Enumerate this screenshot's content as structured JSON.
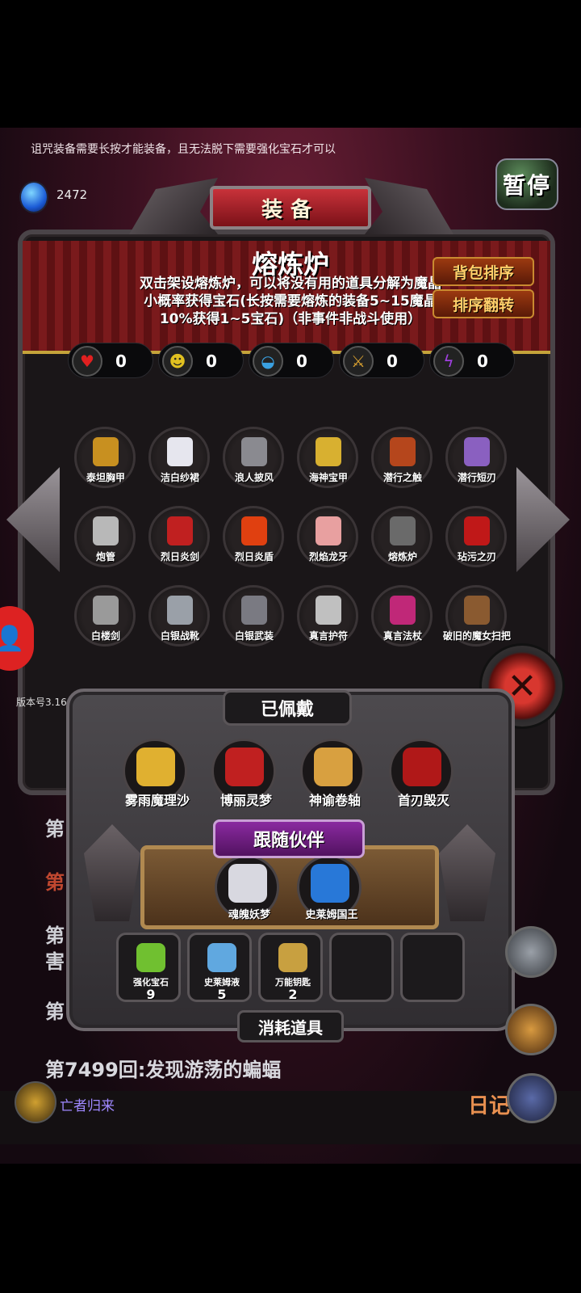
{
  "tip": "诅咒装备需要长按才能装备，且无法脱下需要强化宝石才可以",
  "gem_count": "2472",
  "pause_label": "暂停",
  "panel_title": "装备",
  "furnace": {
    "title": "熔炼炉",
    "description": "双击架设熔炼炉，可以将没有用的道具分解为魔晶小概率获得宝石(长按需要熔炼的装备5~15魔晶10%获得1~5宝石)（非事件非战斗使用）"
  },
  "sort_buttons": [
    "背包排序",
    "排序翻转"
  ],
  "stats": [
    {
      "icon": "heart-icon",
      "value": "0"
    },
    {
      "icon": "strength-icon",
      "value": "0"
    },
    {
      "icon": "helmet-icon",
      "value": "0"
    },
    {
      "icon": "sword-icon",
      "value": "0"
    },
    {
      "icon": "lightning-icon",
      "value": "0"
    }
  ],
  "items": [
    {
      "name": "泰坦胸甲",
      "icon": "gold-armor-icon",
      "color": "#c89020"
    },
    {
      "name": "洁白纱裙",
      "icon": "white-dress-icon",
      "color": "#e6e6ee"
    },
    {
      "name": "浪人披风",
      "icon": "cloak-icon",
      "color": "#8a8a90"
    },
    {
      "name": "海神宝甲",
      "icon": "gold-vest-icon",
      "color": "#d8b030"
    },
    {
      "name": "潜行之触",
      "icon": "glove-icon",
      "color": "#b5461c"
    },
    {
      "name": "潜行短刃",
      "icon": "dagger-icon",
      "color": "#8a60c0"
    },
    {
      "name": "炮管",
      "icon": "cannon-icon",
      "color": "#b8b8b8"
    },
    {
      "name": "烈日炎剑",
      "icon": "flame-sword-icon",
      "color": "#c02020"
    },
    {
      "name": "烈日炎盾",
      "icon": "sun-shield-icon",
      "color": "#e04010"
    },
    {
      "name": "烈焰龙牙",
      "icon": "fang-icon",
      "color": "#e8a0a0"
    },
    {
      "name": "熔炼炉",
      "icon": "cauldron-icon",
      "color": "#6a6a6a"
    },
    {
      "name": "玷污之刃",
      "icon": "cursed-blade-icon",
      "color": "#c01818"
    },
    {
      "name": "白楼剑",
      "icon": "katana-icon",
      "color": "#9a9a9a"
    },
    {
      "name": "白银战靴",
      "icon": "boots-icon",
      "color": "#9aa0a8"
    },
    {
      "name": "白银武装",
      "icon": "knight-armor-icon",
      "color": "#7a7a82"
    },
    {
      "name": "真言护符",
      "icon": "amulet-icon",
      "color": "#c0c0c0"
    },
    {
      "name": "真言法杖",
      "icon": "staff-icon",
      "color": "#c02878"
    },
    {
      "name": "破旧的魔女扫把",
      "icon": "broom-icon",
      "color": "#8a5a30"
    }
  ],
  "version": "版本号3.16",
  "worn": {
    "label": "已佩戴",
    "slots": [
      {
        "name": "雾雨魔理沙",
        "icon": "marisa-icon",
        "color": "#e0b030"
      },
      {
        "name": "博丽灵梦",
        "icon": "reimu-icon",
        "color": "#c02020"
      },
      {
        "name": "神谕卷轴",
        "icon": "scroll-icon",
        "color": "#d8a040"
      },
      {
        "name": "首刃毁灭",
        "icon": "crossed-blades-icon",
        "color": "#b01818"
      }
    ]
  },
  "companions": {
    "label": "跟随伙伴",
    "slots": [
      {
        "name": "魂魄妖梦",
        "icon": "youmu-icon",
        "color": "#d8d8e0"
      },
      {
        "name": "史莱姆国王",
        "icon": "slime-icon",
        "color": "#2878d8"
      }
    ]
  },
  "consumables": {
    "label": "消耗道具",
    "slots": [
      {
        "name": "强化宝石",
        "count": "9",
        "icon": "gem-cluster-icon",
        "color": "#70c030"
      },
      {
        "name": "史莱姆液",
        "count": "5",
        "icon": "potion-icon",
        "color": "#60a8e0"
      },
      {
        "name": "万能钥匙",
        "count": "2",
        "icon": "key-icon",
        "color": "#c8a040"
      }
    ]
  },
  "event_log": "第7499回:发现游荡的蝙蝠",
  "returner": "亡者归来",
  "diary": "日记"
}
